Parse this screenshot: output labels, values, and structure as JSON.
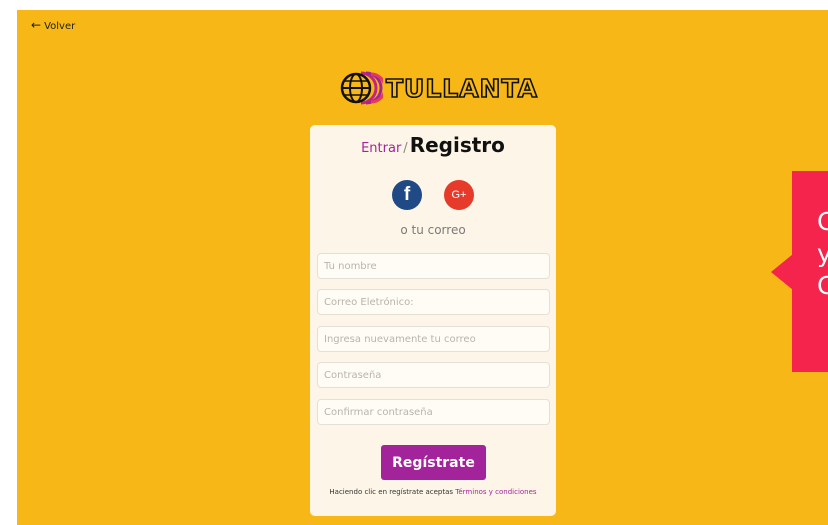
{
  "nav": {
    "back_label": "Volver"
  },
  "logo": {
    "text": "TULLANTA"
  },
  "form": {
    "login_link": "Entrar",
    "separator": "/",
    "title": "Registro",
    "social": {
      "facebook": "f",
      "google": "G+"
    },
    "or_text": "o tu correo",
    "fields": {
      "name_placeholder": "Tu nombre",
      "email_placeholder": "Correo Eletrónico:",
      "email_confirm_placeholder": "Ingresa nuevamente tu correo",
      "password_placeholder": "Contraseña",
      "password_confirm_placeholder": "Confirmar contraseña"
    },
    "submit_label": "Regístrate",
    "terms_prefix": "Haciendo clic en regístrate aceptas ",
    "terms_link": "Términos y condiciones"
  },
  "popup": {
    "lines": [
      "C",
      "y",
      "C"
    ]
  },
  "colors": {
    "background": "#f7b817",
    "accent": "#a3249a",
    "facebook": "#1f4a86",
    "google": "#e63a2b",
    "popup": "#f4244c"
  }
}
